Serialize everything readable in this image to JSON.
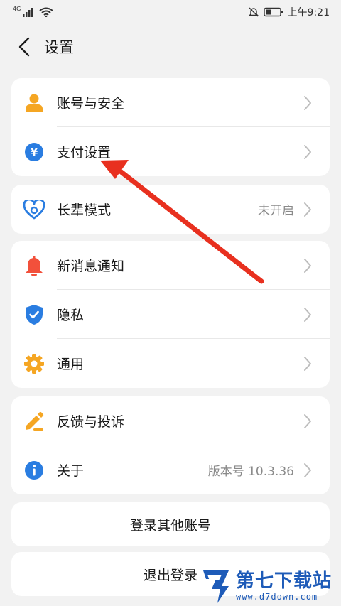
{
  "status_bar": {
    "network": "4G",
    "time_prefix": "上午",
    "time": "9:21"
  },
  "header": {
    "title": "设置"
  },
  "groups": [
    {
      "items": [
        {
          "label": "账号与安全",
          "icon": "person-icon"
        },
        {
          "label": "支付设置",
          "icon": "yuan-icon"
        }
      ]
    },
    {
      "items": [
        {
          "label": "长辈模式",
          "value": "未开启",
          "icon": "heart-icon"
        }
      ]
    },
    {
      "items": [
        {
          "label": "新消息通知",
          "icon": "bell-icon"
        },
        {
          "label": "隐私",
          "icon": "shield-icon"
        },
        {
          "label": "通用",
          "icon": "gear-icon"
        }
      ]
    },
    {
      "items": [
        {
          "label": "反馈与投诉",
          "icon": "pencil-icon"
        },
        {
          "label": "关于",
          "value": "版本号 10.3.36",
          "icon": "info-icon"
        }
      ]
    }
  ],
  "buttons": {
    "switch_account": "登录其他账号",
    "logout": "退出登录"
  },
  "watermark": {
    "main": "第七下载站",
    "sub": "www.d7down.com"
  },
  "colors": {
    "background": "#f2f2f2",
    "card": "#ffffff",
    "orange": "#f5a623",
    "blue": "#2a7de1",
    "red_bell": "#f2503b",
    "annotation_arrow": "#e8301f",
    "watermark": "#1e5bb8"
  }
}
